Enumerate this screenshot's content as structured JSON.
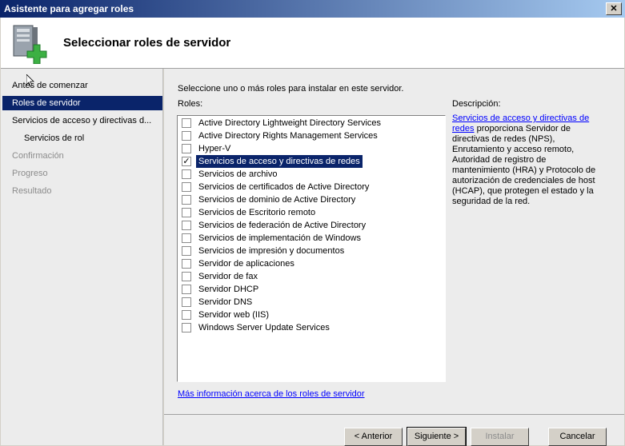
{
  "window": {
    "title": "Asistente para agregar roles",
    "close_label": "✕"
  },
  "header": {
    "page_title": "Seleccionar roles de servidor",
    "icon": "server-add-icon"
  },
  "nav": {
    "items": [
      {
        "label": "Antes de comenzar",
        "state": "normal",
        "level": 0
      },
      {
        "label": "Roles de servidor",
        "state": "active",
        "level": 0
      },
      {
        "label": "Servicios de acceso y directivas d...",
        "state": "normal",
        "level": 0
      },
      {
        "label": "Servicios de rol",
        "state": "normal",
        "level": 1
      },
      {
        "label": "Confirmación",
        "state": "disabled",
        "level": 0
      },
      {
        "label": "Progreso",
        "state": "disabled",
        "level": 0
      },
      {
        "label": "Resultado",
        "state": "disabled",
        "level": 0
      }
    ]
  },
  "main": {
    "instruction": "Seleccione uno o más roles para instalar en este servidor.",
    "roles_label": "Roles:",
    "roles": [
      {
        "label": "Active Directory Lightweight Directory Services",
        "checked": false
      },
      {
        "label": "Active Directory Rights Management Services",
        "checked": false
      },
      {
        "label": "Hyper-V",
        "checked": false
      },
      {
        "label": "Servicios de acceso y directivas de redes",
        "checked": true,
        "selected": true
      },
      {
        "label": "Servicios de archivo",
        "checked": false
      },
      {
        "label": "Servicios de certificados de Active Directory",
        "checked": false
      },
      {
        "label": "Servicios de dominio de Active Directory",
        "checked": false
      },
      {
        "label": "Servicios de Escritorio remoto",
        "checked": false
      },
      {
        "label": "Servicios de federación de Active Directory",
        "checked": false
      },
      {
        "label": "Servicios de implementación de Windows",
        "checked": false
      },
      {
        "label": "Servicios de impresión y documentos",
        "checked": false
      },
      {
        "label": "Servidor de aplicaciones",
        "checked": false
      },
      {
        "label": "Servidor de fax",
        "checked": false
      },
      {
        "label": "Servidor DHCP",
        "checked": false
      },
      {
        "label": "Servidor DNS",
        "checked": false
      },
      {
        "label": "Servidor web (IIS)",
        "checked": false
      },
      {
        "label": "Windows Server Update Services",
        "checked": false
      }
    ],
    "description_label": "Descripción:",
    "description_link": "Servicios de acceso y directivas de redes",
    "description_text": " proporciona Servidor de directivas de redes (NPS), Enrutamiento y acceso remoto, Autoridad de registro de mantenimiento (HRA) y Protocolo de autorización de credenciales de host (HCAP), que protegen el estado y la seguridad de la red.",
    "more_info_link": "Más información acerca de los roles de servidor"
  },
  "footer": {
    "back_label": "< Anterior",
    "next_label": "Siguiente >",
    "install_label": "Instalar",
    "cancel_label": "Cancelar"
  },
  "colors": {
    "selection": "#0a246a",
    "link": "#0000ff",
    "accent_plus": "#3cb043"
  }
}
